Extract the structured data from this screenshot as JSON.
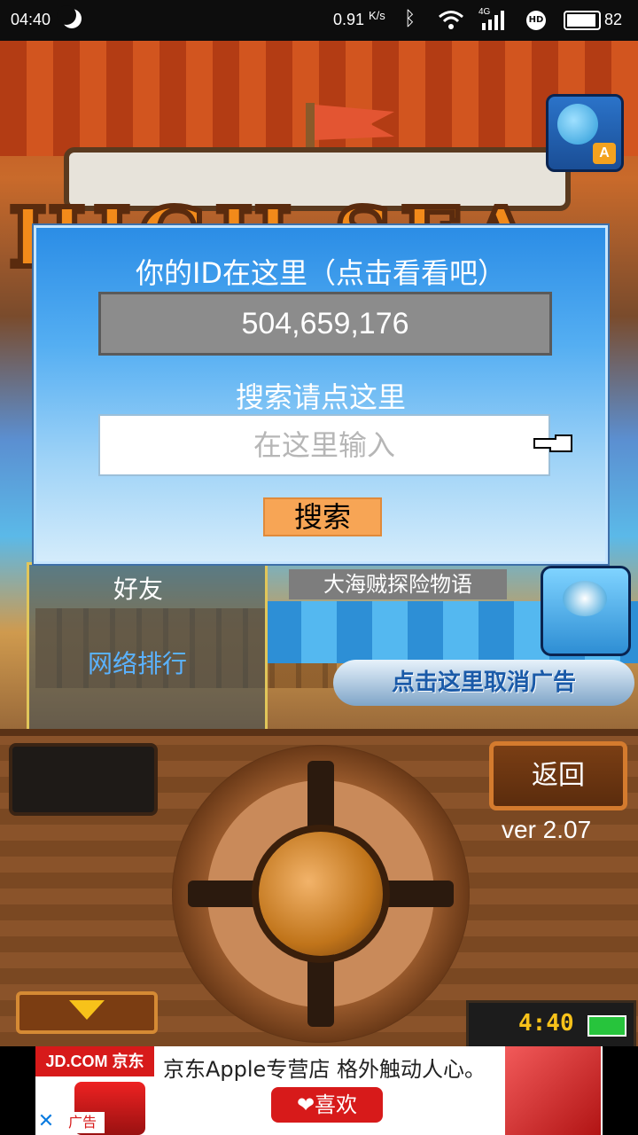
{
  "status_bar": {
    "time": "04:40",
    "net_speed": "0.91",
    "net_unit": "K/s",
    "network": "4G",
    "battery": "82",
    "icons": [
      "moon-icon",
      "bluetooth-icon",
      "wifi-icon",
      "signal-icon",
      "hd-icon",
      "battery-icon"
    ]
  },
  "game": {
    "logo_text": "HIGH SEA",
    "friend_label": "好友",
    "ranking_label": "网络排行",
    "story_tag": "大海贼探险物语",
    "cancel_ad_button": "点击这里取消广告"
  },
  "dialog": {
    "title": "你的ID在这里（点击看看吧）",
    "player_id": "504,659,176",
    "search_title": "搜索请点这里",
    "search_placeholder": "在这里输入",
    "search_button": "搜索"
  },
  "controls": {
    "back_button": "返回",
    "version": "ver 2.07",
    "clock": "4:40"
  },
  "ad": {
    "brand": "JD.COM 京东",
    "headline": "京东Apple专营店  格外触动人心。",
    "like_button": "❤喜欢",
    "ad_label": "广告",
    "close_symbol": "✕"
  },
  "colors": {
    "dialog_blue": "#2b8de6",
    "search_button": "#f7a555",
    "ad_red": "#d71a1a",
    "clock_yellow": "#f7c21a"
  }
}
